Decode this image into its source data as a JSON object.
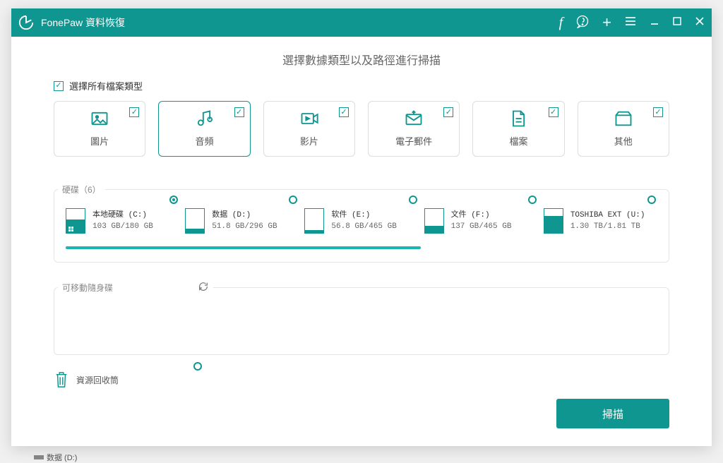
{
  "app_title": "FonePaw 資料恢復",
  "page_heading": "選擇數據類型以及路徑進行掃描",
  "select_all_label": "選擇所有檔案類型",
  "file_types": [
    {
      "id": "image",
      "label": "圖片"
    },
    {
      "id": "audio",
      "label": "音頻"
    },
    {
      "id": "video",
      "label": "影片"
    },
    {
      "id": "email",
      "label": "電子郵件"
    },
    {
      "id": "document",
      "label": "檔案"
    },
    {
      "id": "other",
      "label": "其他"
    }
  ],
  "drives_section": {
    "label": "硬碟（6）",
    "drives": [
      {
        "name": "本地硬碟 (C:)",
        "size": "103 GB/180 GB",
        "fill": 57,
        "selected": true,
        "system": true
      },
      {
        "name": "数据 (D:)",
        "size": "51.8 GB/296 GB",
        "fill": 18,
        "selected": false
      },
      {
        "name": "软件 (E:)",
        "size": "56.8 GB/465 GB",
        "fill": 12,
        "selected": false
      },
      {
        "name": "文件 (F:)",
        "size": "137 GB/465 GB",
        "fill": 30,
        "selected": false
      },
      {
        "name": "TOSHIBA EXT (U:)",
        "size": "1.30 TB/1.81 TB",
        "fill": 72,
        "selected": false
      }
    ]
  },
  "removable_section": {
    "label": "可移動隨身碟"
  },
  "recycle_bin_label": "資源回收筒",
  "scan_button": "掃描",
  "bg_item": "数据 (D:)",
  "colors": {
    "brand": "#0f9690"
  }
}
